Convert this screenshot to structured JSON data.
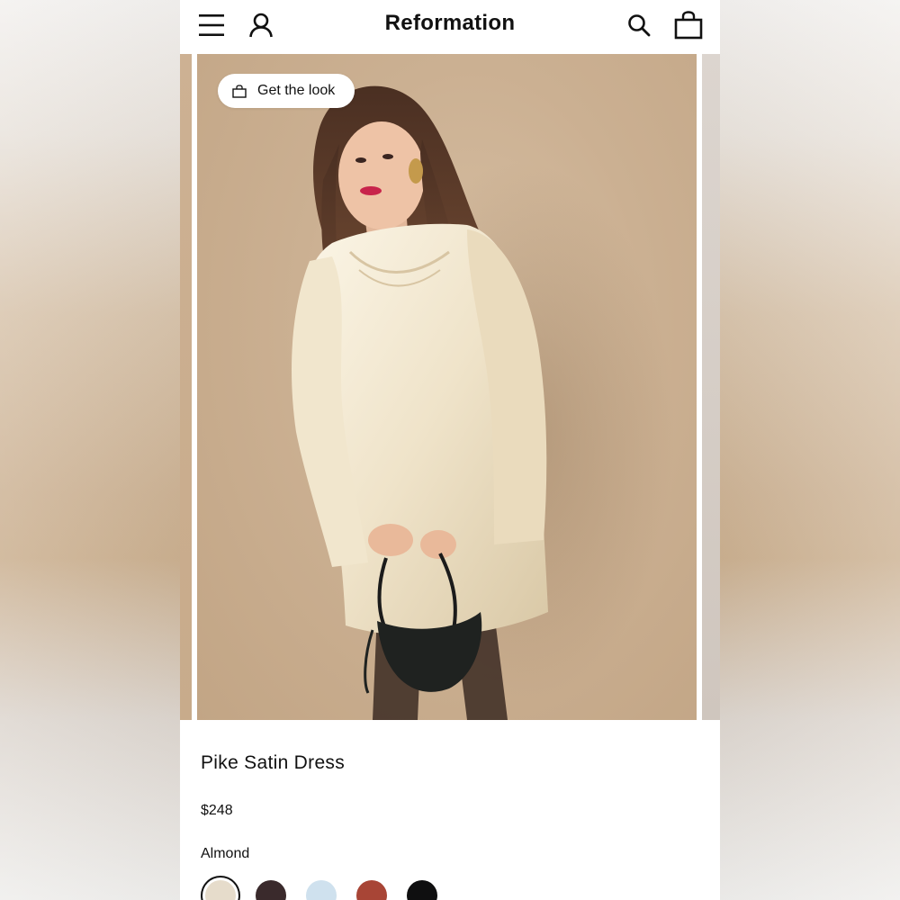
{
  "header": {
    "brand": "Reformation",
    "menu_icon": "menu-icon",
    "account_icon": "account-icon",
    "search_icon": "search-icon",
    "bag_icon": "shopping-bag-icon"
  },
  "gallery": {
    "get_the_look_label": "Get the look",
    "get_the_look_icon": "shopping-bag-icon"
  },
  "product": {
    "name": "Pike Satin Dress",
    "price": "$248",
    "selected_color": "Almond",
    "swatches": [
      {
        "name": "almond",
        "hex": "#e6dccb",
        "selected": true
      },
      {
        "name": "dark-brown",
        "hex": "#3a2a2c",
        "selected": false
      },
      {
        "name": "light-blue",
        "hex": "#cfe1ee",
        "selected": false
      },
      {
        "name": "rust",
        "hex": "#a84536",
        "selected": false
      },
      {
        "name": "black",
        "hex": "#0f0f10",
        "selected": false
      }
    ]
  },
  "colors": {
    "text": "#111111",
    "background": "#ffffff",
    "photo_background": "#c9ad8e"
  }
}
